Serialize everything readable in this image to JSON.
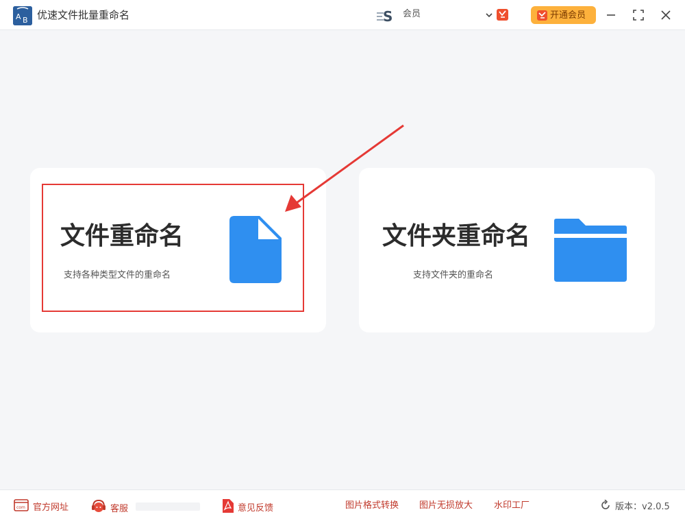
{
  "titlebar": {
    "app_title": "优速文件批量重命名",
    "member_name": "会员",
    "vip_button_label": "开通会员"
  },
  "cards": {
    "file": {
      "title": "文件重命名",
      "description": "支持各种类型文件的重命名"
    },
    "folder": {
      "title": "文件夹重命名",
      "description": "支持文件夹的重命名"
    }
  },
  "footer": {
    "website_label": "官方网址",
    "support_label": "客服",
    "feedback_label": "意见反馈",
    "links": [
      "图片格式转换",
      "图片无损放大",
      "水印工厂"
    ],
    "version_label": "版本：v2.0.5"
  },
  "colors": {
    "accent_blue": "#2f8ff0",
    "annotation_red": "#e53935",
    "vip_orange": "#fdb13c"
  }
}
